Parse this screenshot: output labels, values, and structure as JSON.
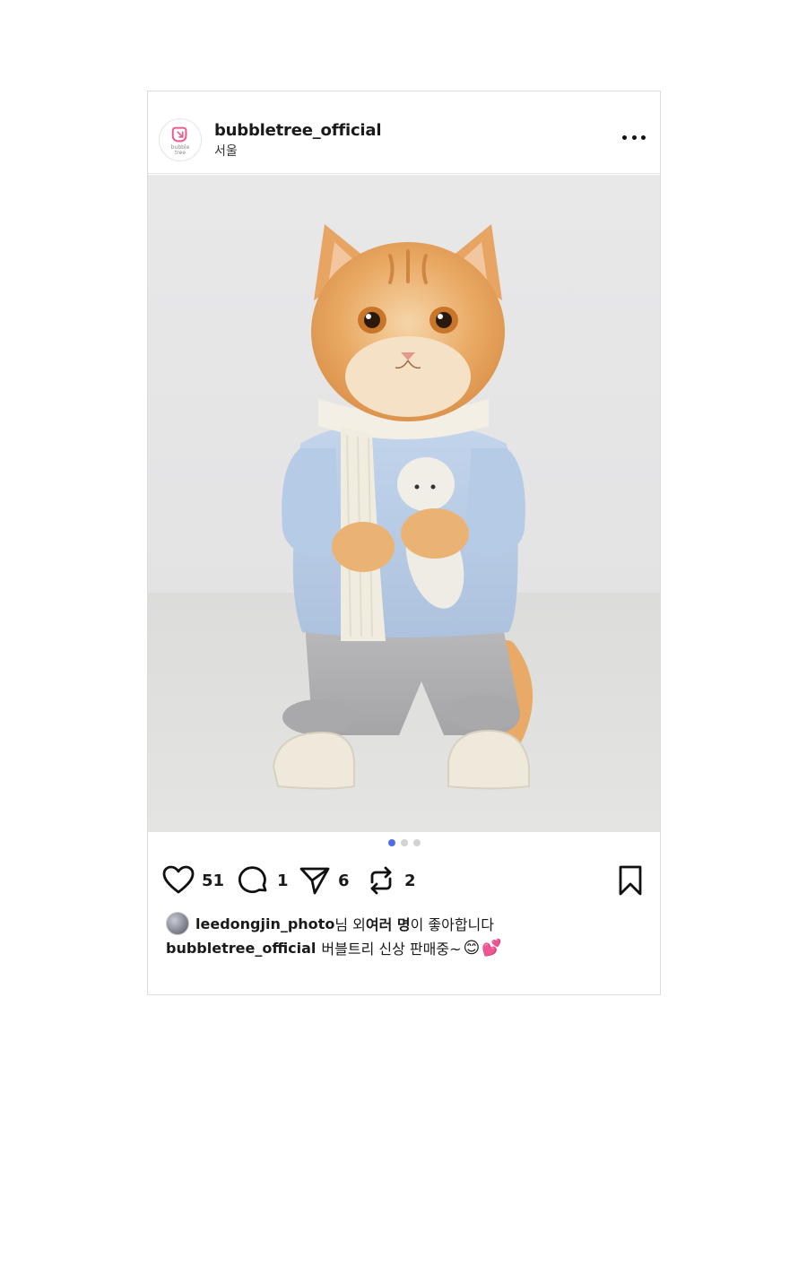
{
  "post": {
    "account": {
      "username": "bubbletree_official",
      "location": "서울",
      "avatar_logo_text_line1": "bubble",
      "avatar_logo_text_line2": "tree",
      "brand_color": "#e85d8f"
    },
    "more_icon": "more-horizontal-icon",
    "carousel": {
      "total_images": 3,
      "current_index": 1,
      "active_color": "#4f6cf0",
      "inactive_color": "#d3d3d3"
    },
    "actions": {
      "like": {
        "icon": "heart-icon",
        "count": "51"
      },
      "comment": {
        "icon": "comment-icon",
        "count": "1"
      },
      "share": {
        "icon": "send-icon",
        "count": "6"
      },
      "repost": {
        "icon": "repost-icon",
        "count": "2"
      },
      "save": {
        "icon": "bookmark-icon"
      }
    },
    "likes": {
      "liker_username": "leedongjin_photo",
      "text_mid": "님 외 ",
      "text_bold": "여러 명",
      "text_end": "이 좋아합니다"
    },
    "caption": {
      "username": "bubbletree_official",
      "text": "버블트리 신상 판매중~",
      "emoji_1": "😊",
      "emoji_2": "💕"
    }
  }
}
